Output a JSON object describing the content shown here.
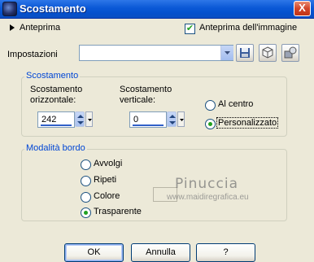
{
  "window": {
    "title": "Scostamento",
    "close_label": "X"
  },
  "preview": {
    "toggle_label": "Anteprima",
    "image_preview_label": "Anteprima dell'immagine",
    "image_preview_checked": true
  },
  "settings": {
    "label": "Impostazioni",
    "value": ""
  },
  "offset": {
    "group_label": "Scostamento",
    "horizontal_label_line1": "Scostamento",
    "horizontal_label_line2": "orizzontale:",
    "horizontal_value": "242",
    "vertical_label_line1": "Scostamento",
    "vertical_label_line2": "verticale:",
    "vertical_value": "0",
    "center_label": "Al centro",
    "custom_label": "Personalizzato",
    "selected": "Personalizzato"
  },
  "edge_mode": {
    "group_label": "Modalità bordo",
    "options": [
      "Avvolgi",
      "Ripeti",
      "Colore",
      "Trasparente"
    ],
    "selected": "Trasparente"
  },
  "buttons": {
    "ok": "OK",
    "cancel": "Annulla",
    "help": "?"
  },
  "watermark": {
    "title": "Pinuccia",
    "url": "www.maidiregrafica.eu"
  },
  "colors": {
    "accent_blue": "#0046d5",
    "titlebar": "#0a58d6",
    "dialog_bg": "#ece9d8"
  }
}
